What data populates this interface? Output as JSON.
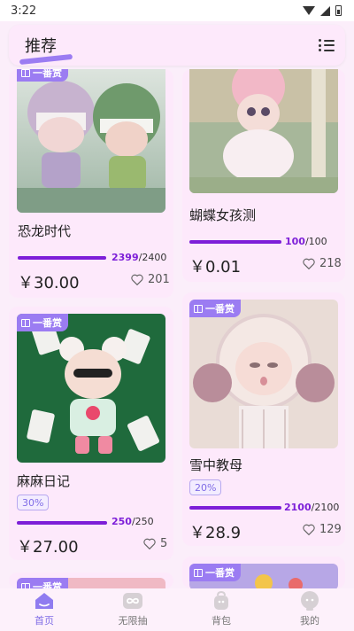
{
  "status": {
    "time": "3:22"
  },
  "header": {
    "title": "推荐"
  },
  "badge_label": "一番赏",
  "cards": [
    {
      "name": "恐龙时代",
      "progress_value": "2399",
      "progress_total": "/2400",
      "progress_ratio": 0.9996,
      "price": "￥30.00",
      "likes": "201",
      "pct": ""
    },
    {
      "name": "蝴蝶女孩测",
      "progress_value": "100",
      "progress_total": "/100",
      "progress_ratio": 1.0,
      "price": "￥0.01",
      "likes": "218",
      "pct": ""
    },
    {
      "name": "麻麻日记",
      "progress_value": "250",
      "progress_total": "/250",
      "progress_ratio": 1.0,
      "price": "￥27.00",
      "likes": "5",
      "pct": "30%"
    },
    {
      "name": "雪中教母",
      "progress_value": "2100",
      "progress_total": "/2100",
      "progress_ratio": 1.0,
      "price": "￥28.9",
      "likes": "129",
      "pct": "20%"
    }
  ],
  "nav": [
    {
      "label": "首页",
      "active": true
    },
    {
      "label": "无限抽",
      "active": false
    },
    {
      "label": "背包",
      "active": false
    },
    {
      "label": "我的",
      "active": false
    }
  ],
  "colors": {
    "accent": "#9b7cf2",
    "progress": "#7d1fd8",
    "background": "#fbeefa"
  }
}
